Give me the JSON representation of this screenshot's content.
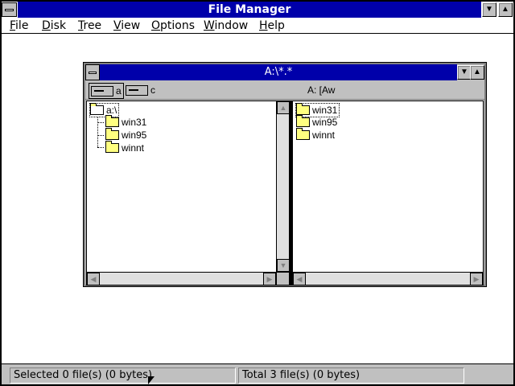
{
  "window": {
    "title": "File Manager",
    "minimize_glyph": "▼",
    "maximize_glyph": "▲"
  },
  "menu": [
    {
      "label": "File",
      "accel": "F",
      "rest": "ile"
    },
    {
      "label": "Disk",
      "accel": "D",
      "rest": "isk"
    },
    {
      "label": "Tree",
      "accel": "T",
      "rest": "ree"
    },
    {
      "label": "View",
      "accel": "V",
      "rest": "iew"
    },
    {
      "label": "Options",
      "accel": "O",
      "rest": "ptions"
    },
    {
      "label": "Window",
      "accel": "W",
      "rest": "indow"
    },
    {
      "label": "Help",
      "accel": "H",
      "rest": "elp"
    }
  ],
  "child": {
    "title": "A:\\*.*",
    "drives": [
      {
        "letter": "a",
        "selected": true
      },
      {
        "letter": "c",
        "selected": false
      }
    ],
    "volume_label": "A: [Aw",
    "tree": {
      "root": "a:\\",
      "folders": [
        "win31",
        "win95",
        "winnt"
      ]
    },
    "files": [
      "win31",
      "win95",
      "winnt"
    ]
  },
  "status": {
    "selected": "Selected 0 file(s) (0 bytes)",
    "total": "Total 3 file(s) (0 bytes)"
  },
  "colors": {
    "title_bar": "#0000aa",
    "window_face": "#c0c0c0",
    "folder": "#ffff80"
  },
  "icons": {
    "system_menu": "system-menu-icon",
    "drive": "floppy-drive-icon",
    "folder": "folder-icon",
    "open_folder": "open-folder-icon"
  }
}
